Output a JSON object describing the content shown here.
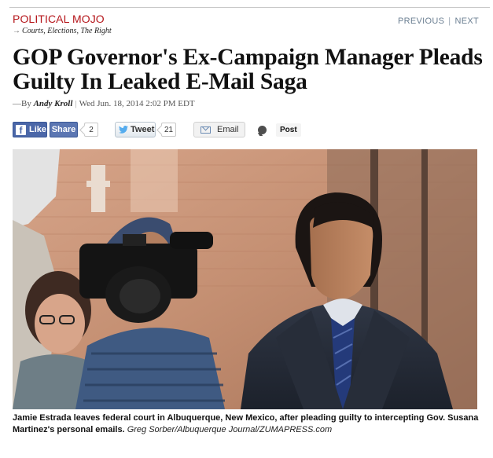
{
  "section": {
    "name": "POLITICAL MOJO",
    "arrow": "→",
    "tags": "Courts, Elections, The Right"
  },
  "nav": {
    "previous": "PREVIOUS",
    "separator": "|",
    "next": "NEXT"
  },
  "article": {
    "headline": "GOP Governor's Ex-Campaign Manager Pleads Guilty In Leaked E-Mail Saga",
    "byline_prefix": "—By",
    "author": "Andy Kroll",
    "byline_sep": "|",
    "date": "Wed Jun. 18, 2014 2:02 PM EDT"
  },
  "share": {
    "fb_icon": "f",
    "like_label": "Like",
    "share_label": "Share",
    "share_count": "2",
    "tweet_label": "Tweet",
    "tweet_count": "21",
    "email_label": "Email",
    "post_label": "Post",
    "icons": [
      "facebook-icon",
      "twitter-bird-icon",
      "mail-icon",
      "speech-bubble-icon"
    ]
  },
  "photo": {
    "caption": "Jamie Estrada leaves federal court in Albuquerque, New Mexico, after pleading guilty to intercepting Gov. Susana Martinez's personal emails.",
    "credit": "Greg Sorber/Albuquerque Journal/ZUMAPRESS.com"
  },
  "colors": {
    "section_red": "#b5161b",
    "nav_gray_blue": "#6b7f92",
    "facebook_blue": "#4b67a8"
  }
}
